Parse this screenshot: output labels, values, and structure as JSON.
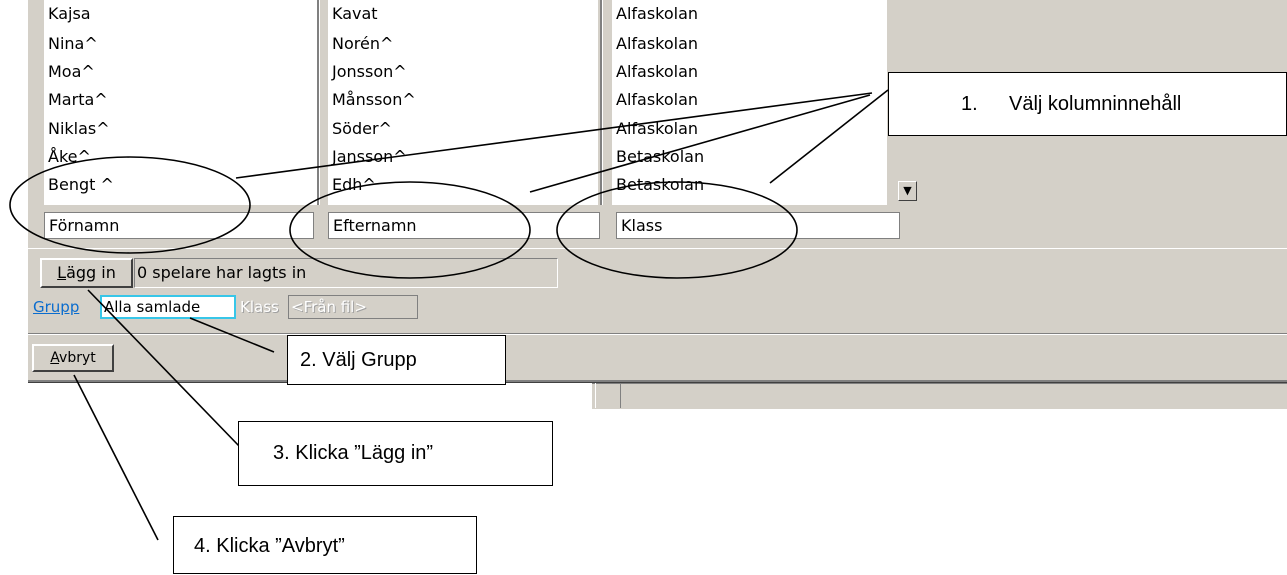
{
  "columns": {
    "fornamn": [
      "Kajsa",
      "Nina^",
      "Moa^",
      "Marta^",
      "Niklas^",
      "Åke^",
      "Bengt ^"
    ],
    "efternamn": [
      "Kavat",
      "Norén^",
      "Jonsson^",
      "Månsson^",
      "Söder^",
      "Jansson^",
      "Edh^"
    ],
    "klass": [
      "Alfaskolan",
      "Alfaskolan",
      "Alfaskolan",
      "Alfaskolan",
      "Alfaskolan",
      "Betaskolan",
      "Betaskolan"
    ]
  },
  "dropdown_icon": "▼",
  "fields": {
    "fornamn": "Förnamn",
    "efternamn": "Efternamn",
    "klass": "Klass"
  },
  "lagg_in": {
    "label_first": "L",
    "label_rest": "ägg in",
    "status": "0 spelare har lagts in"
  },
  "grupp": {
    "label": "Grupp",
    "value": "Alla samlade"
  },
  "klass_fil": {
    "label": "Klass",
    "value": "<Från fil>"
  },
  "avbryt": {
    "label_first": "A",
    "label_rest": "vbryt"
  },
  "callouts": {
    "c1_num": "1.",
    "c1_text": "Välj kolumninnehåll",
    "c2": "2. Välj Grupp",
    "c3": "3. Klicka ”Lägg in”",
    "c4": "4. Klicka ”Avbryt”"
  },
  "colors": {
    "dialog_bg": "#d4d0c8",
    "grupp_accent": "#0a6cce",
    "focus_border": "#37c6e8"
  }
}
